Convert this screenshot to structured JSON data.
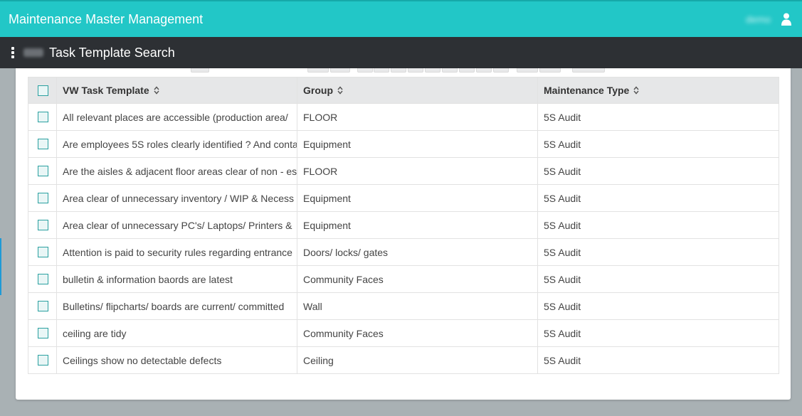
{
  "header": {
    "app_title": "Maintenance Master Management",
    "username": "demo"
  },
  "subheader": {
    "page_title": "Task Template Search"
  },
  "table": {
    "columns": [
      {
        "label": "VW Task Template"
      },
      {
        "label": "Group"
      },
      {
        "label": "Maintenance Type"
      }
    ],
    "rows": [
      {
        "template": "All relevant places are accessible (production area/ ",
        "group": "FLOOR",
        "type": "5S Audit"
      },
      {
        "template": "Are employees 5S roles clearly identified ? And conta",
        "group": "Equipment",
        "type": "5S Audit"
      },
      {
        "template": "Are the aisles & adjacent floor areas clear of non - es",
        "group": "FLOOR",
        "type": "5S Audit"
      },
      {
        "template": "Area clear of unnecessary inventory / WIP & Necess",
        "group": "Equipment",
        "type": "5S Audit"
      },
      {
        "template": "Area clear of unnecessary PC's/ Laptops/ Printers &",
        "group": "Equipment",
        "type": "5S Audit"
      },
      {
        "template": "Attention is paid to security rules regarding entrance",
        "group": "Doors/ locks/ gates",
        "type": "5S Audit"
      },
      {
        "template": "bulletin & information baords are latest",
        "group": "Community Faces",
        "type": "5S Audit"
      },
      {
        "template": "Bulletins/ flipcharts/ boards are current/ committed",
        "group": "Wall",
        "type": "5S Audit"
      },
      {
        "template": "ceiling are tidy",
        "group": "Community Faces",
        "type": "5S Audit"
      },
      {
        "template": "Ceilings show no detectable defects",
        "group": "Ceiling",
        "type": "5S Audit"
      }
    ]
  },
  "icons": {
    "user": "user-icon",
    "menu": "kebab-menu-icon",
    "sort": "sort-icon"
  },
  "colors": {
    "brand": "#22c7c7",
    "subbar": "#2d3034",
    "checkbox_border": "#2aa0a0"
  }
}
